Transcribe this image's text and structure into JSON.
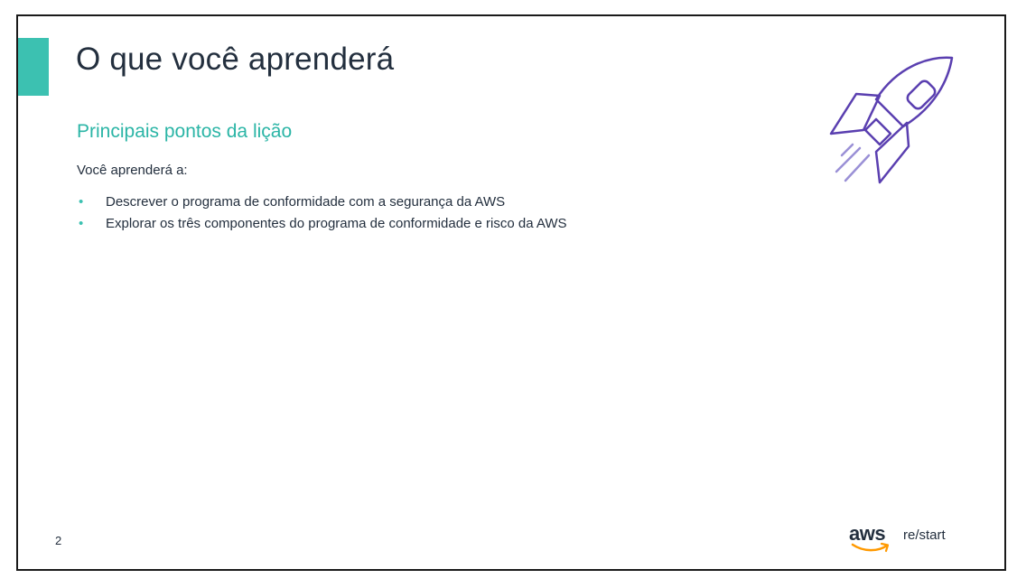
{
  "slide": {
    "title": "O que você aprenderá",
    "subtitle": "Principais pontos da lição",
    "intro": "Você aprenderá a:",
    "bullets": [
      "Descrever o programa de conformidade com a segurança da AWS",
      "Explorar os três componentes do programa de conformidade e risco da AWS"
    ],
    "page_number": "2"
  },
  "logo": {
    "wordmark": "aws",
    "product": "re/start"
  },
  "icons": {
    "illustration": "rocket-icon",
    "bullet": "bullet-dot-icon",
    "logo_smile": "aws-smile-icon"
  },
  "colors": {
    "accent": "#3cc1b1",
    "subtitle": "#2bb5a6",
    "title_text": "#232f3e",
    "rocket": "#5a3fb0",
    "rocket_trail": "#9a90d6",
    "logo_smile": "#ff9900"
  }
}
